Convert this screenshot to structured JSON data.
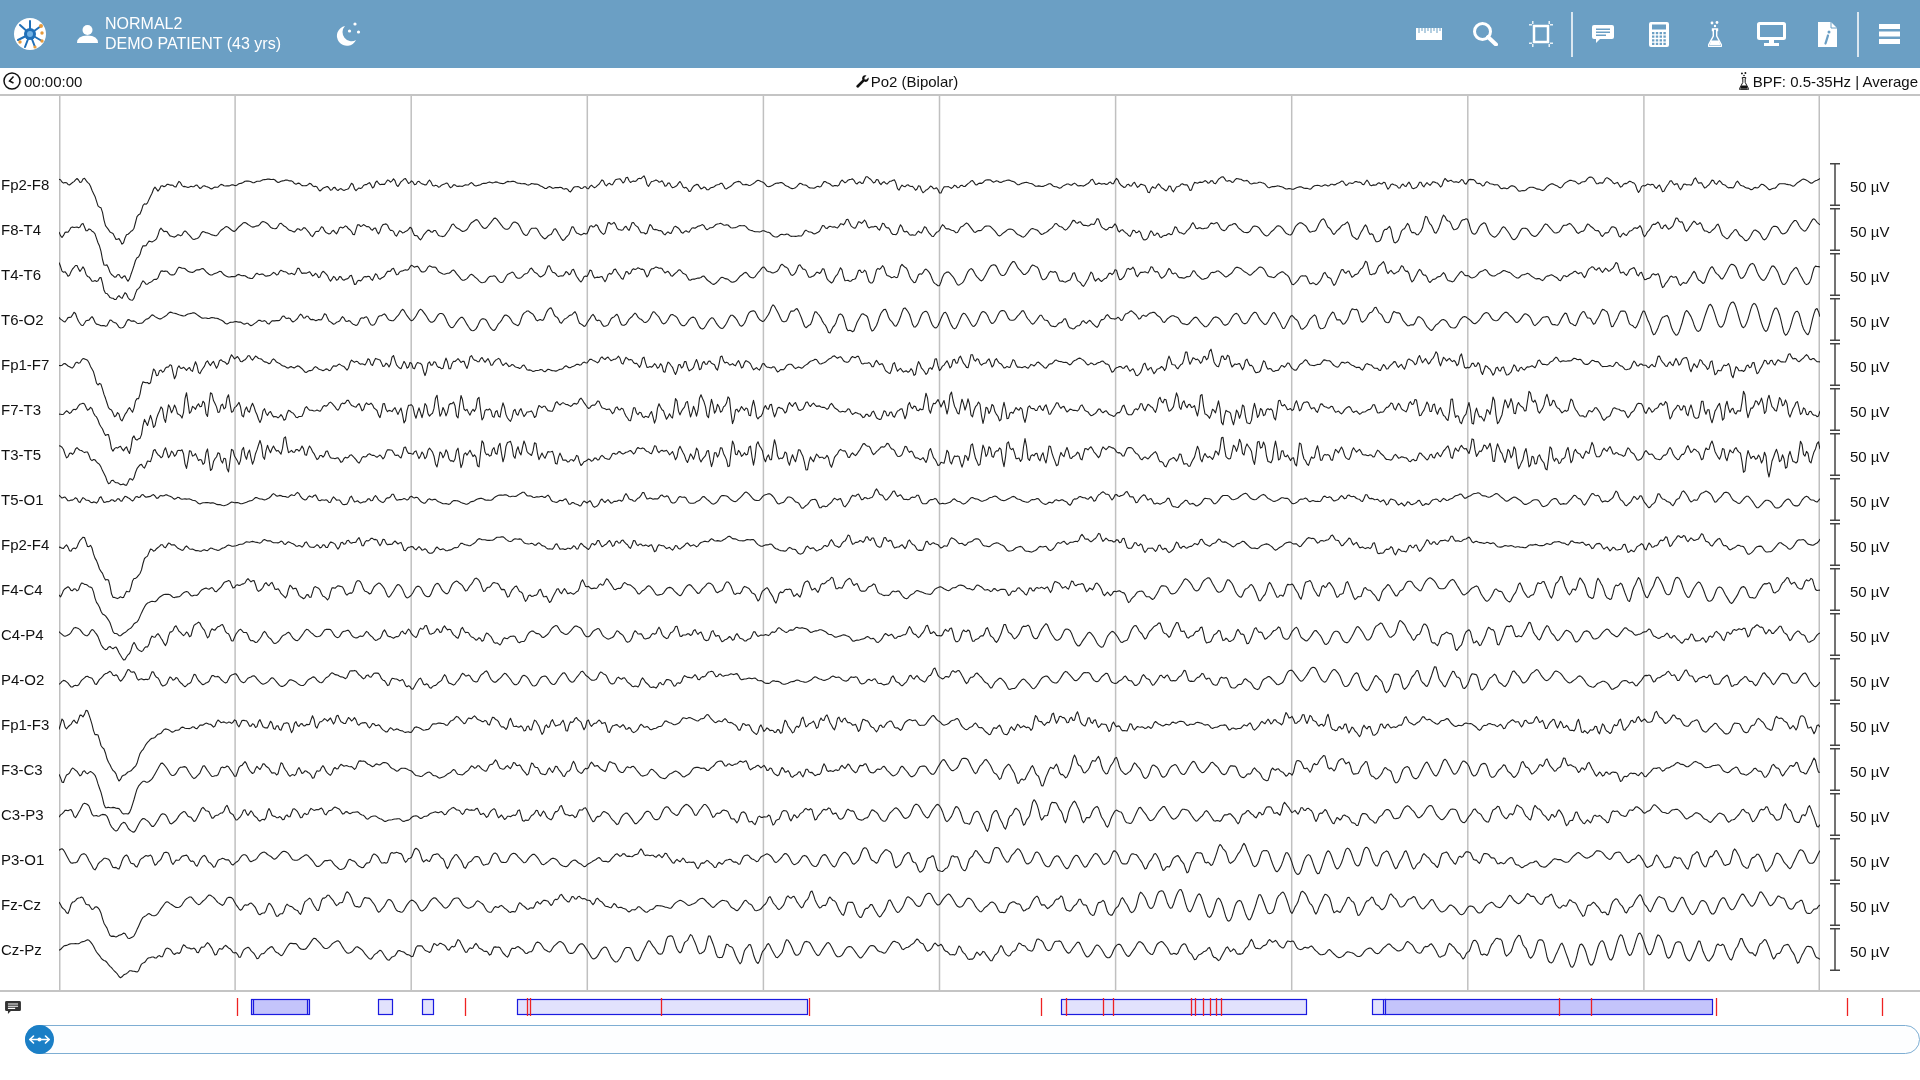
{
  "header": {
    "patient": {
      "name": "NORMAL2",
      "details": "DEMO PATIENT (43 yrs)"
    }
  },
  "info_bar": {
    "time": "00:00:00",
    "montage": "Po2 (Bipolar)",
    "filter": "BPF: 0.5-35Hz | Average"
  },
  "channels": [
    {
      "label": "Fp2-F8",
      "scale": "50 µV"
    },
    {
      "label": "F8-T4",
      "scale": "50 µV"
    },
    {
      "label": "T4-T6",
      "scale": "50 µV"
    },
    {
      "label": "T6-O2",
      "scale": "50 µV"
    },
    {
      "label": "Fp1-F7",
      "scale": "50 µV"
    },
    {
      "label": "F7-T3",
      "scale": "50 µV"
    },
    {
      "label": "T3-T5",
      "scale": "50 µV"
    },
    {
      "label": "T5-O1",
      "scale": "50 µV"
    },
    {
      "label": "Fp2-F4",
      "scale": "50 µV"
    },
    {
      "label": "F4-C4",
      "scale": "50 µV"
    },
    {
      "label": "C4-P4",
      "scale": "50 µV"
    },
    {
      "label": "P4-O2",
      "scale": "50 µV"
    },
    {
      "label": "Fp1-F3",
      "scale": "50 µV"
    },
    {
      "label": "F3-C3",
      "scale": "50 µV"
    },
    {
      "label": "C3-P3",
      "scale": "50 µV"
    },
    {
      "label": "P3-O1",
      "scale": "50 µV"
    },
    {
      "label": "Fz-Cz",
      "scale": "50 µV"
    },
    {
      "label": "Cz-Pz",
      "scale": "50 µV"
    }
  ]
}
